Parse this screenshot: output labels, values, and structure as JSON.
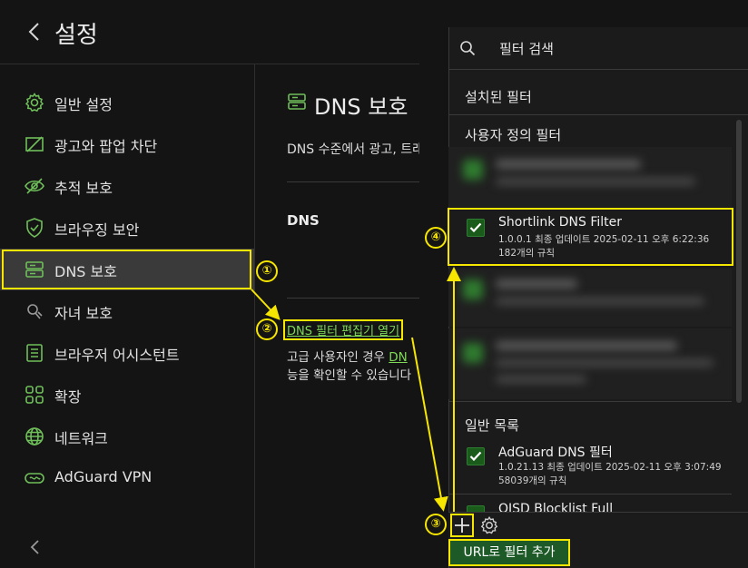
{
  "header": {
    "title": "설정"
  },
  "sidebar": {
    "items": [
      {
        "label": "일반 설정",
        "icon": "gear-icon"
      },
      {
        "label": "광고와 팝업 차단",
        "icon": "ad-block-icon"
      },
      {
        "label": "추적 보호",
        "icon": "eye-off-icon"
      },
      {
        "label": "브라우징 보안",
        "icon": "shield-icon"
      },
      {
        "label": "DNS 보호",
        "icon": "dns-server-icon"
      },
      {
        "label": "자녀 보호",
        "icon": "parental-icon"
      },
      {
        "label": "브라우저 어시스턴트",
        "icon": "assistant-icon"
      },
      {
        "label": "확장",
        "icon": "extensions-icon"
      },
      {
        "label": "네트워크",
        "icon": "globe-icon"
      },
      {
        "label": "AdGuard VPN",
        "icon": "vpn-icon"
      }
    ]
  },
  "main": {
    "title": "DNS 보호",
    "description": "DNS 수준에서 광고, 트래",
    "dns_heading": "DNS",
    "editor_link": "DNS 필터 편집기 열기",
    "advanced_text_1": "고급 사용자인 경우 ",
    "advanced_link": "DN",
    "advanced_text_2": "능을 확인할 수 있습니다"
  },
  "callouts": [
    "①",
    "②",
    "③",
    "④"
  ],
  "filter_panel": {
    "search_placeholder": "필터 검색",
    "installed_title": "설치된 필터",
    "custom_title": "사용자 정의 필터",
    "highlighted_filter": {
      "name": "Shortlink DNS Filter",
      "meta": "1.0.0.1 최종 업데이트 2025-02-11 오후 6:22:36",
      "rules": "182개의 규칙",
      "checked": true
    },
    "general_title": "일반 목록",
    "general_filters": [
      {
        "name": "AdGuard DNS 필터",
        "meta": "1.0.21.13 최종 업데이트 2025-02-11 오후 3:07:49",
        "rules": "58039개의 규칙",
        "checked": true
      },
      {
        "name": "OISD Blocklist Full",
        "meta": "",
        "rules": "",
        "checked": true
      }
    ],
    "add_url_button": "URL로 필터 추가"
  },
  "colors": {
    "highlight": "#f7e600",
    "accent_green": "#7ed957",
    "background": "#141414"
  }
}
